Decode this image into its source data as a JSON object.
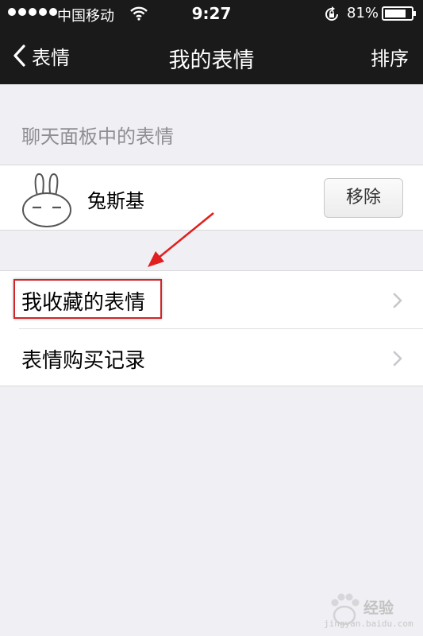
{
  "status_bar": {
    "carrier": "中国移动",
    "time": "9:27",
    "battery_percent": "81%",
    "battery_level": 0.81,
    "signal_bars": 5
  },
  "nav": {
    "back_label": "表情",
    "title": "我的表情",
    "right_action": "排序"
  },
  "section_header": "聊天面板中的表情",
  "sticker_pack": {
    "name": "兔斯基",
    "remove_label": "移除"
  },
  "menu": {
    "items": [
      {
        "label": "我收藏的表情",
        "icon": "chevron-right-icon"
      },
      {
        "label": "表情购买记录",
        "icon": "chevron-right-icon"
      }
    ]
  },
  "annotation": {
    "highlight_color": "#d0262a",
    "arrow_color": "#e02020"
  },
  "watermark": {
    "text": "经验",
    "url": "jingyan.baidu.com"
  }
}
